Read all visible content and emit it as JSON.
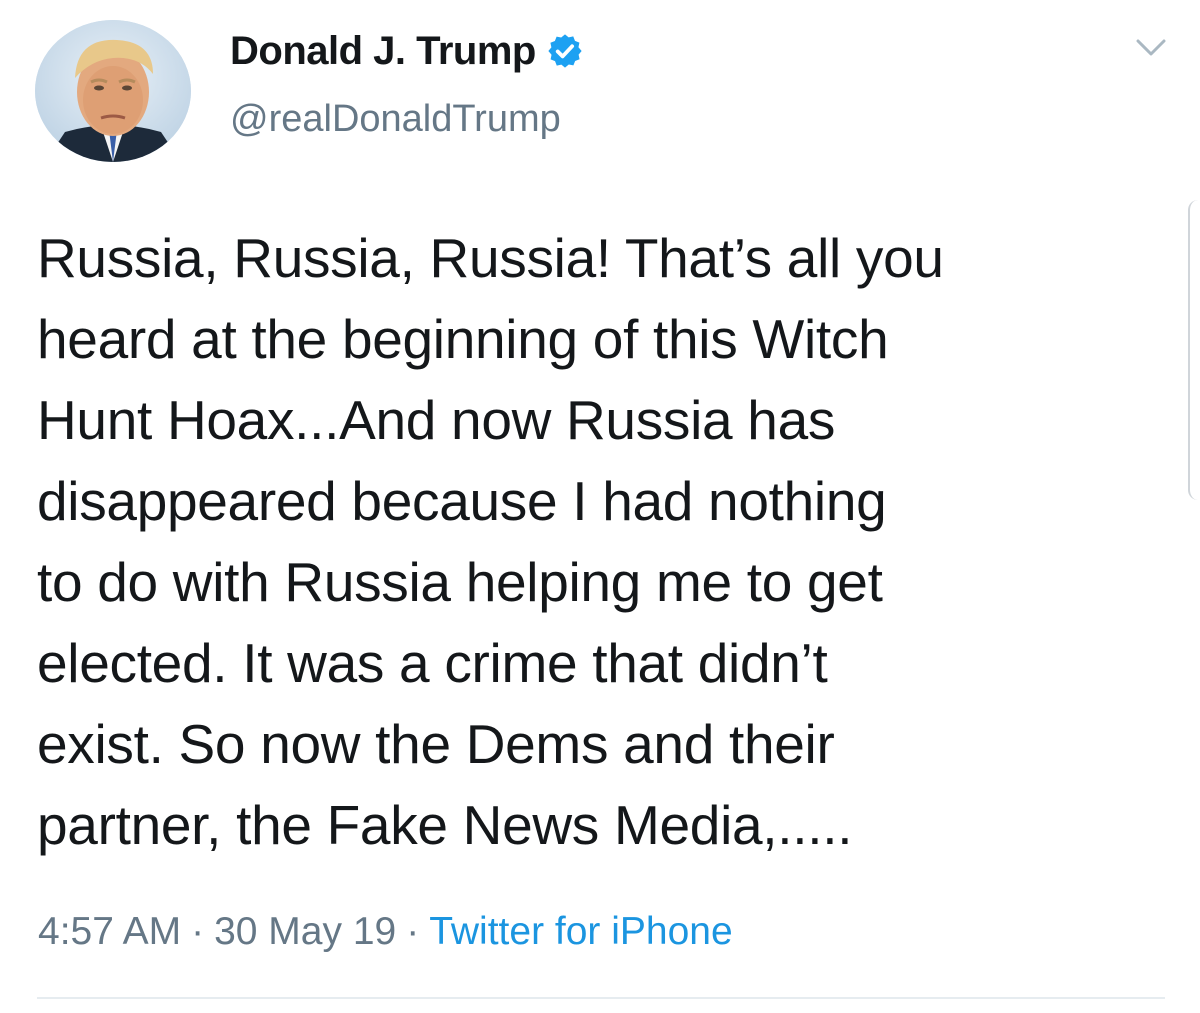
{
  "tweet": {
    "author": {
      "display_name": "Donald J. Trump",
      "handle": "@realDonaldTrump",
      "verified": true,
      "avatar_icon": "profile-photo"
    },
    "menu_icon": "chevron-down-icon",
    "text": "Russia, Russia, Russia! That’s all you\nheard at the beginning of this Witch\nHunt Hoax...And now Russia has\ndisappeared because I had nothing\nto do with Russia helping me to get\nelected. It was a crime that didn’t\nexist. So now the Dems and their\npartner, the Fake News Media,.....",
    "time": "4:57 AM",
    "date": "30 May 19",
    "separator": "·",
    "source": "Twitter for iPhone"
  },
  "colors": {
    "text_primary": "#14171a",
    "text_secondary": "#657786",
    "link": "#1b95e0",
    "verified_badge": "#1da1f2",
    "divider": "#e6ecf0"
  }
}
